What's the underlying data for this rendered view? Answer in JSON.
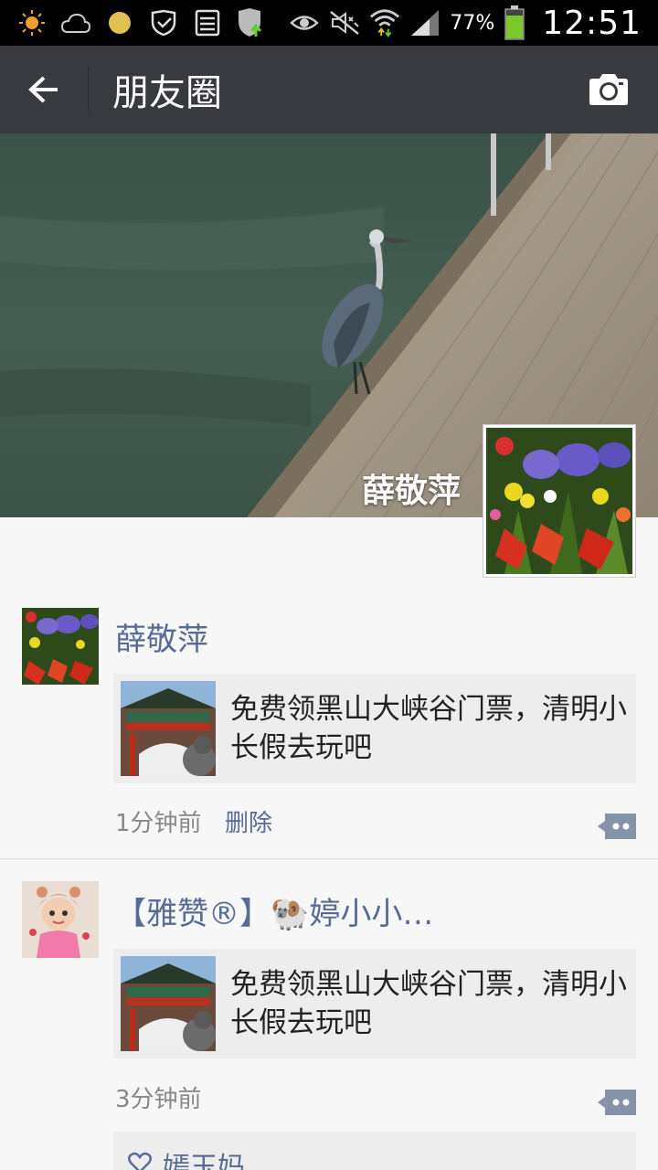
{
  "status_bar": {
    "battery_percent": "77%",
    "time": "12:51",
    "icons": [
      "weather-sun-icon",
      "weather-cloud-icon",
      "dot-icon",
      "shield-check-icon",
      "storage-icon",
      "shield-upload-icon",
      "eye-icon",
      "mute-icon",
      "wifi-icon",
      "signal-icon",
      "battery-icon"
    ]
  },
  "app_bar": {
    "title": "朋友圈",
    "back_icon": "arrow-left-icon",
    "camera_icon": "camera-icon"
  },
  "cover": {
    "user_name": "薛敬萍"
  },
  "posts": [
    {
      "author": "薛敬萍",
      "share_text": "免费领黑山大峡谷门票，清明小长假去玩吧",
      "time": "1分钟前",
      "delete_label": "删除"
    },
    {
      "author": "【雅赞®】🐏婷小小…",
      "share_text": "免费领黑山大峡谷门票，清明小长假去玩吧",
      "time": "3分钟前",
      "likes": [
        "嫣玉妈"
      ]
    }
  ]
}
